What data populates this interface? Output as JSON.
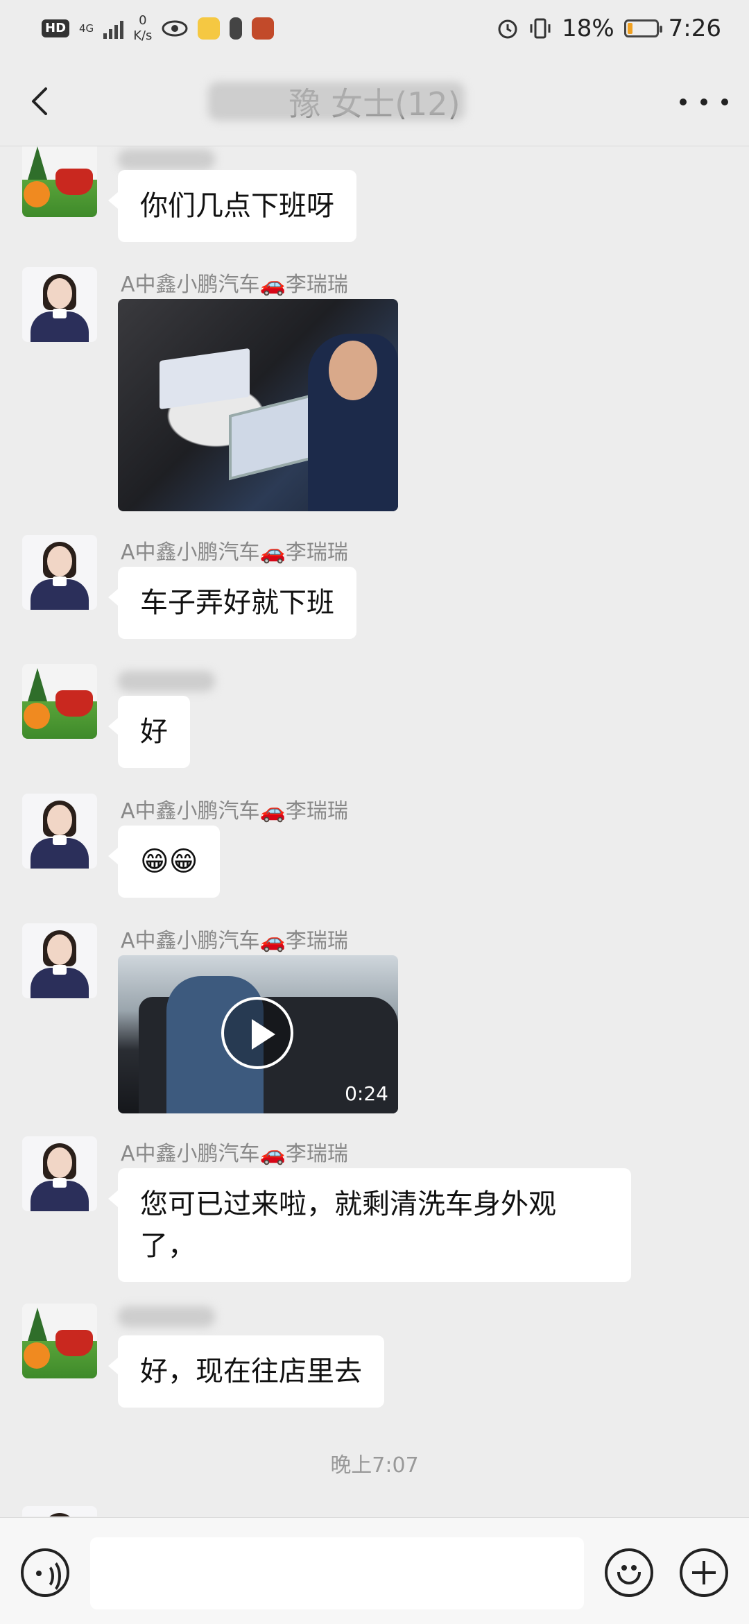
{
  "status_bar": {
    "hd": "HD",
    "network": "4G",
    "speed_value": "0",
    "speed_unit": "K/s",
    "battery_percent": "18%",
    "battery_level": 0.18,
    "time": "7:26"
  },
  "header": {
    "title": "豫 女士(12)"
  },
  "messages": [
    {
      "sender": "",
      "text": "你们几点下班呀"
    },
    {
      "sender": "A中鑫小鹏汽车🚗李瑞瑞",
      "type": "image"
    },
    {
      "sender": "A中鑫小鹏汽车🚗李瑞瑞",
      "text": "车子弄好就下班"
    },
    {
      "sender": "",
      "text": "好"
    },
    {
      "sender": "A中鑫小鹏汽车🚗李瑞瑞",
      "text": "😁😁"
    },
    {
      "sender": "A中鑫小鹏汽车🚗李瑞瑞",
      "type": "video",
      "duration": "0:24"
    },
    {
      "sender": "A中鑫小鹏汽车🚗李瑞瑞",
      "text_line1": "您可已过来啦，就剩清洗车身外观",
      "text_line2": "了，"
    },
    {
      "sender": "",
      "text": "好，现在往店里去"
    }
  ],
  "timestamp": "晚上7:07",
  "colors": {
    "background": "#ededed",
    "bubble": "#ffffff",
    "sender_name": "#888888",
    "battery_fill": "#f0a020"
  },
  "icons": {
    "back": "chevron-left-icon",
    "more": "more-dots-icon",
    "voice": "voice-icon",
    "emoji": "emoji-icon",
    "plus": "plus-icon"
  }
}
